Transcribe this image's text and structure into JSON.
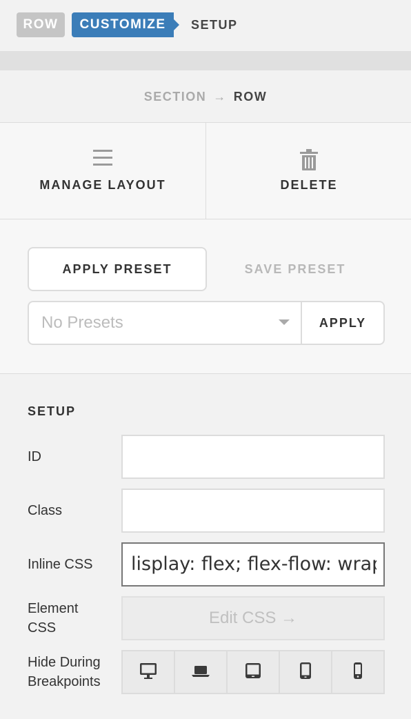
{
  "breadcrumb": {
    "row_badge": "ROW",
    "customize_badge": "CUSTOMIZE",
    "setup_label": "SETUP"
  },
  "path": {
    "section": "SECTION",
    "arrow": "→",
    "row": "ROW"
  },
  "actions": {
    "manage_layout": {
      "label": "MANAGE LAYOUT",
      "icon": "hamburger-icon"
    },
    "delete": {
      "label": "DELETE",
      "icon": "trash-icon"
    }
  },
  "presets": {
    "apply_preset_label": "APPLY PRESET",
    "save_preset_label": "SAVE PRESET",
    "select_value": "No Presets",
    "apply_label": "APPLY"
  },
  "setup": {
    "title": "SETUP",
    "id_label": "ID",
    "id_value": "",
    "class_label": "Class",
    "class_value": "",
    "inline_css_label": "Inline CSS",
    "inline_css_value": "lisplay: flex; flex-flow: wrap",
    "element_css_label_1": "Element",
    "element_css_label_2": "CSS",
    "edit_css_label": "Edit CSS →",
    "hide_label_1": "Hide During",
    "hide_label_2": "Breakpoints",
    "breakpoints": [
      "desktop-icon",
      "laptop-icon",
      "tablet-landscape-icon",
      "tablet-portrait-icon",
      "phone-icon"
    ]
  },
  "colors": {
    "accent": "#3b7db8",
    "muted_badge": "#c5c5c5"
  }
}
